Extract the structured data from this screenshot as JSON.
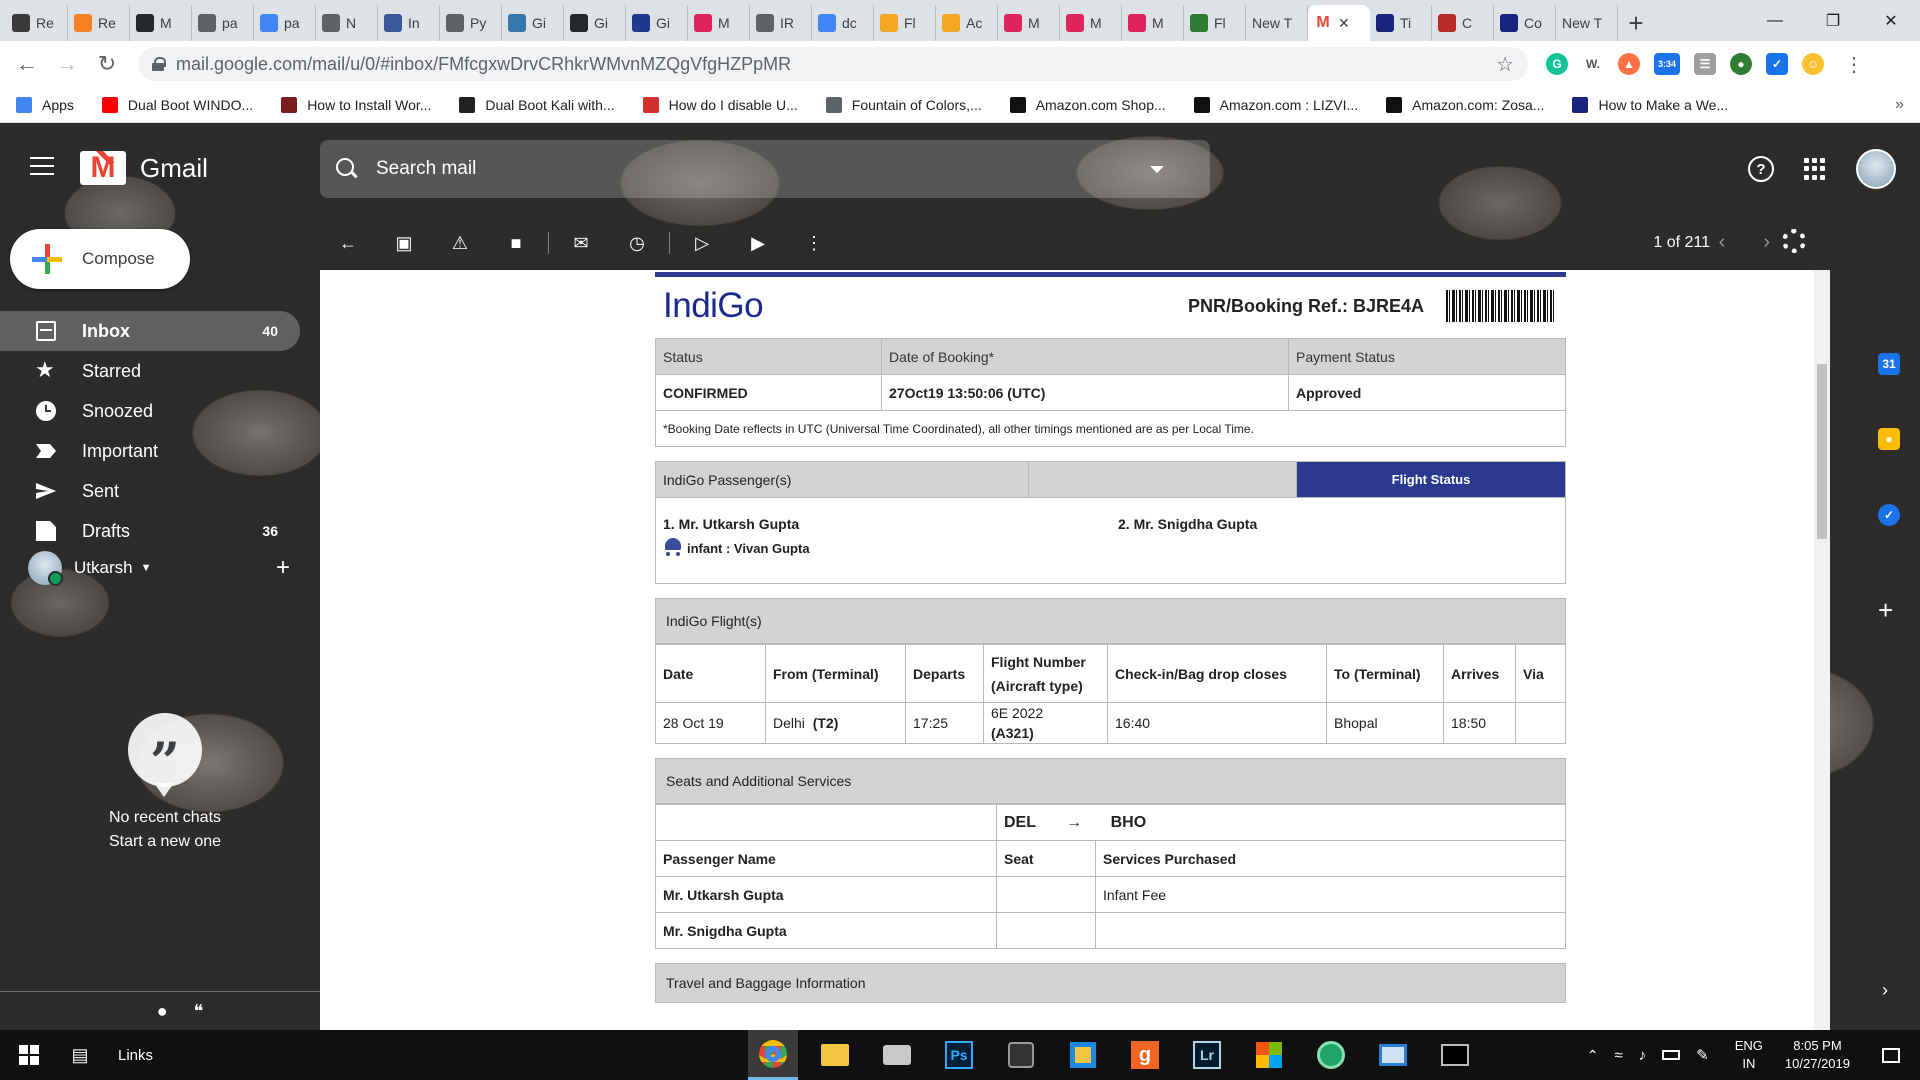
{
  "browser": {
    "tabs": [
      {
        "label": "Re",
        "icon": "edge-icon",
        "color": "#3a3a3a"
      },
      {
        "label": "Re",
        "icon": "stack-icon",
        "color": "#f48024"
      },
      {
        "label": "M",
        "icon": "github-icon",
        "color": "#24292e"
      },
      {
        "label": "pa",
        "icon": "globe-icon",
        "color": "#5f6368"
      },
      {
        "label": "pa",
        "icon": "google-icon",
        "color": "#4285f4"
      },
      {
        "label": "N",
        "icon": "globe-icon",
        "color": "#5f6368"
      },
      {
        "label": "In",
        "icon": "page-icon",
        "color": "#3b5998"
      },
      {
        "label": "Py",
        "icon": "globe-icon",
        "color": "#5f6368"
      },
      {
        "label": "Gi",
        "icon": "python-icon",
        "color": "#3776ab"
      },
      {
        "label": "Gi",
        "icon": "github-icon",
        "color": "#24292e"
      },
      {
        "label": "Gi",
        "icon": "github-icon",
        "color": "#1f3a8a"
      },
      {
        "label": "M",
        "icon": "mail-icon",
        "color": "#e0245e"
      },
      {
        "label": "IR",
        "icon": "globe-icon",
        "color": "#5f6368"
      },
      {
        "label": "dc",
        "icon": "google-icon",
        "color": "#4285f4"
      },
      {
        "label": "Fl",
        "icon": "q-icon",
        "color": "#f5a623"
      },
      {
        "label": "Ac",
        "icon": "q-icon",
        "color": "#f5a623"
      },
      {
        "label": "M",
        "icon": "mail-icon",
        "color": "#e0245e"
      },
      {
        "label": "M",
        "icon": "mail-icon",
        "color": "#e0245e"
      },
      {
        "label": "M",
        "icon": "mail-icon",
        "color": "#e0245e"
      },
      {
        "label": "Fl",
        "icon": "g-icon",
        "color": "#2e7d32"
      },
      {
        "label": "New T",
        "icon": "",
        "color": ""
      },
      {
        "label": "",
        "icon": "gmail-icon",
        "color": "#ea4335",
        "active": true
      },
      {
        "label": "Ti",
        "icon": "page-icon",
        "color": "#1a237e"
      },
      {
        "label": "C",
        "icon": "quora-icon",
        "color": "#b92b27"
      },
      {
        "label": "Co",
        "icon": "page-icon",
        "color": "#1a237e"
      },
      {
        "label": "New T",
        "icon": "",
        "color": ""
      }
    ],
    "url": "mail.google.com/mail/u/0/#inbox/FMfcgxwDrvCRhkrWMvnMZQgVfgHZPpMR",
    "ext_badge": "3:34",
    "bookmarks": [
      {
        "label": "Apps",
        "icon": "apps-icon",
        "color": "#4285f4"
      },
      {
        "label": "Dual Boot WINDO...",
        "icon": "youtube-icon",
        "color": "#ff0000"
      },
      {
        "label": "How to Install Wor...",
        "icon": "wp-icon",
        "color": "#7a1f1f"
      },
      {
        "label": "Dual Boot Kali with...",
        "icon": "kali-icon",
        "color": "#222222"
      },
      {
        "label": "How do I disable U...",
        "icon": "r-icon",
        "color": "#d32f2f"
      },
      {
        "label": "Fountain of Colors,...",
        "icon": "globe-icon",
        "color": "#5f6368"
      },
      {
        "label": "Amazon.com Shop...",
        "icon": "amazon-icon",
        "color": "#111111"
      },
      {
        "label": "Amazon.com : LIZVI...",
        "icon": "amazon-icon",
        "color": "#111111"
      },
      {
        "label": "Amazon.com: Zosa...",
        "icon": "amazon-icon",
        "color": "#111111"
      },
      {
        "label": "How to Make a We...",
        "icon": "shield-icon",
        "color": "#1a237e"
      }
    ]
  },
  "gmail": {
    "brand": "Gmail",
    "search_placeholder": "Search mail",
    "compose_label": "Compose",
    "nav": [
      {
        "label": "Inbox",
        "count": "40",
        "active": true
      },
      {
        "label": "Starred",
        "count": ""
      },
      {
        "label": "Snoozed",
        "count": ""
      },
      {
        "label": "Important",
        "count": ""
      },
      {
        "label": "Sent",
        "count": ""
      },
      {
        "label": "Drafts",
        "count": "36"
      }
    ],
    "user": "Utkarsh",
    "chat_empty": "No recent chats",
    "chat_start": "Start a new one",
    "pager": "1 of 211",
    "side_badge": "31"
  },
  "email": {
    "logo": "IndiGo",
    "pnr": "PNR/Booking Ref.: BJRE4A",
    "booking": {
      "headers": [
        "Status",
        "Date of Booking*",
        "Payment Status"
      ],
      "values": [
        "CONFIRMED",
        "27Oct19 13:50:06 (UTC)",
        "Approved"
      ],
      "note": "*Booking Date reflects in UTC (Universal Time Coordinated), all other timings mentioned are as per Local Time."
    },
    "passengers": {
      "header": "IndiGo Passenger(s)",
      "status_btn": "Flight Status",
      "p1": "1. Mr. Utkarsh Gupta",
      "p2": "2. Mr. Snigdha Gupta",
      "infant": "infant : Vivan Gupta"
    },
    "flights": {
      "header": "IndiGo Flight(s)",
      "columns": [
        "Date",
        "From (Terminal)",
        "Departs",
        "Flight Number",
        "(Aircraft type)",
        "Check-in/Bag drop closes",
        "To (Terminal)",
        "Arrives",
        "Via"
      ],
      "row": {
        "date": "28 Oct 19",
        "from": "Delhi",
        "terminal": "(T2)",
        "departs": "17:25",
        "flight": "6E 2022",
        "aircraft": "(A321)",
        "checkin": "16:40",
        "to": "Bhopal",
        "arrives": "18:50",
        "via": ""
      }
    },
    "seats": {
      "header": "Seats and Additional Services",
      "from_code": "DEL",
      "arrow": "→",
      "to_code": "BHO",
      "columns": [
        "Passenger Name",
        "Seat",
        "Services Purchased"
      ],
      "rows": [
        {
          "name": "Mr. Utkarsh Gupta",
          "seat": "",
          "services": "Infant Fee"
        },
        {
          "name": "Mr. Snigdha Gupta",
          "seat": "",
          "services": ""
        }
      ]
    },
    "baggage_header": "Travel and Baggage Information"
  },
  "taskbar": {
    "links_label": "Links",
    "lang1": "ENG",
    "lang2": "IN",
    "time": "8:05 PM",
    "date": "10/27/2019"
  }
}
